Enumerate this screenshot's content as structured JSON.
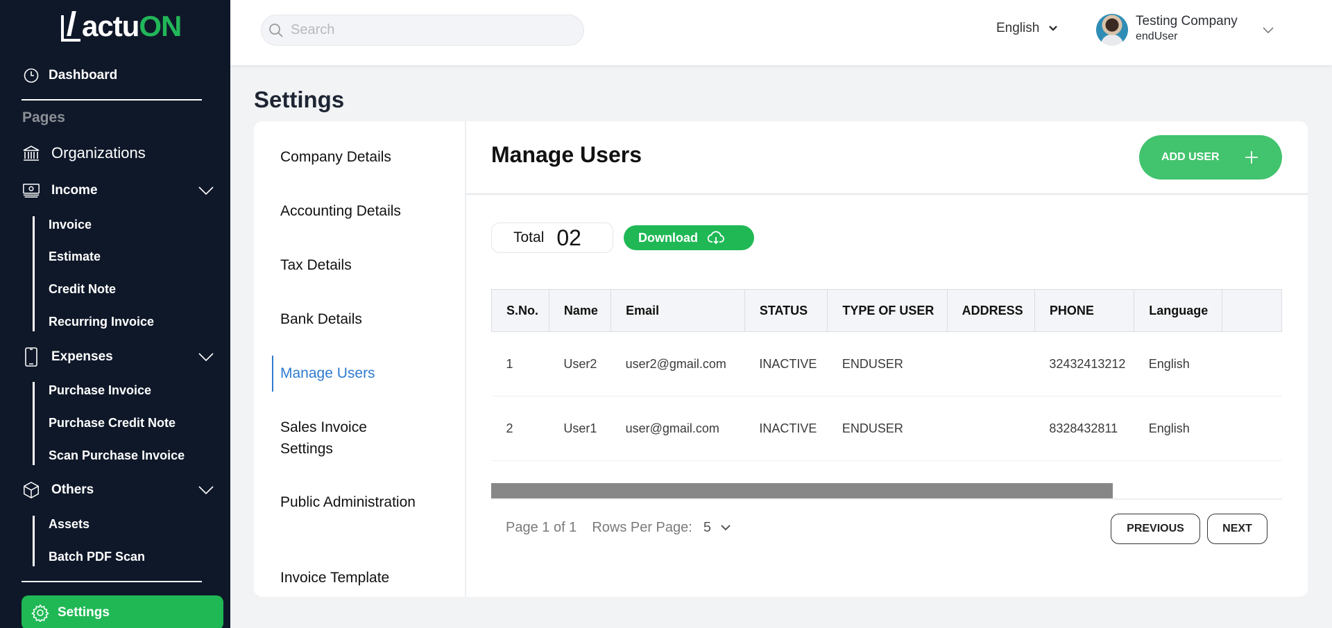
{
  "brand": {
    "logo_white": "actu",
    "logo_green": "ON"
  },
  "sidebar": {
    "dashboard": "Dashboard",
    "pages_label": "Pages",
    "organizations": "Organizations",
    "income": {
      "label": "Income",
      "items": [
        "Invoice",
        "Estimate",
        "Credit Note",
        "Recurring Invoice"
      ]
    },
    "expenses": {
      "label": "Expenses",
      "items": [
        "Purchase Invoice",
        "Purchase Credit Note",
        "Scan Purchase Invoice"
      ]
    },
    "others": {
      "label": "Others",
      "items": [
        "Assets",
        "Batch PDF Scan"
      ]
    },
    "settings": "Settings"
  },
  "header": {
    "search_placeholder": "Search",
    "language": "English",
    "user_name": "Testing Company",
    "user_role": "endUser"
  },
  "page_title": "Settings",
  "settings_nav": [
    "Company Details",
    "Accounting Details",
    "Tax Details",
    "Bank Details",
    "Manage Users",
    "Sales Invoice Settings",
    "Public Administration",
    "Invoice Template"
  ],
  "settings_nav_active": "Manage Users",
  "manage_users": {
    "title": "Manage Users",
    "add_user": "ADD USER",
    "total_label": "Total",
    "total_value": "02",
    "download": "Download",
    "columns": [
      "S.No.",
      "Name",
      "Email",
      "STATUS",
      "TYPE OF USER",
      "ADDRESS",
      "PHONE",
      "Language",
      ""
    ],
    "rows": [
      [
        "1",
        "User2",
        "user2@gmail.com",
        "INACTIVE",
        "ENDUSER",
        "",
        "32432413212",
        "English",
        ""
      ],
      [
        "2",
        "User1",
        "user@gmail.com",
        "INACTIVE",
        "ENDUSER",
        "",
        "8328432811",
        "English",
        ""
      ]
    ],
    "pagination": {
      "page_info": "Page 1 of 1",
      "rows_per_page_label": "Rows Per Page:",
      "rows_per_page_value": "5",
      "previous": "PREVIOUS",
      "next": "NEXT"
    }
  },
  "colors": {
    "sidebar_bg": "#0f1829",
    "accent_green": "#1fb855",
    "active_link": "#2f7bd0"
  }
}
